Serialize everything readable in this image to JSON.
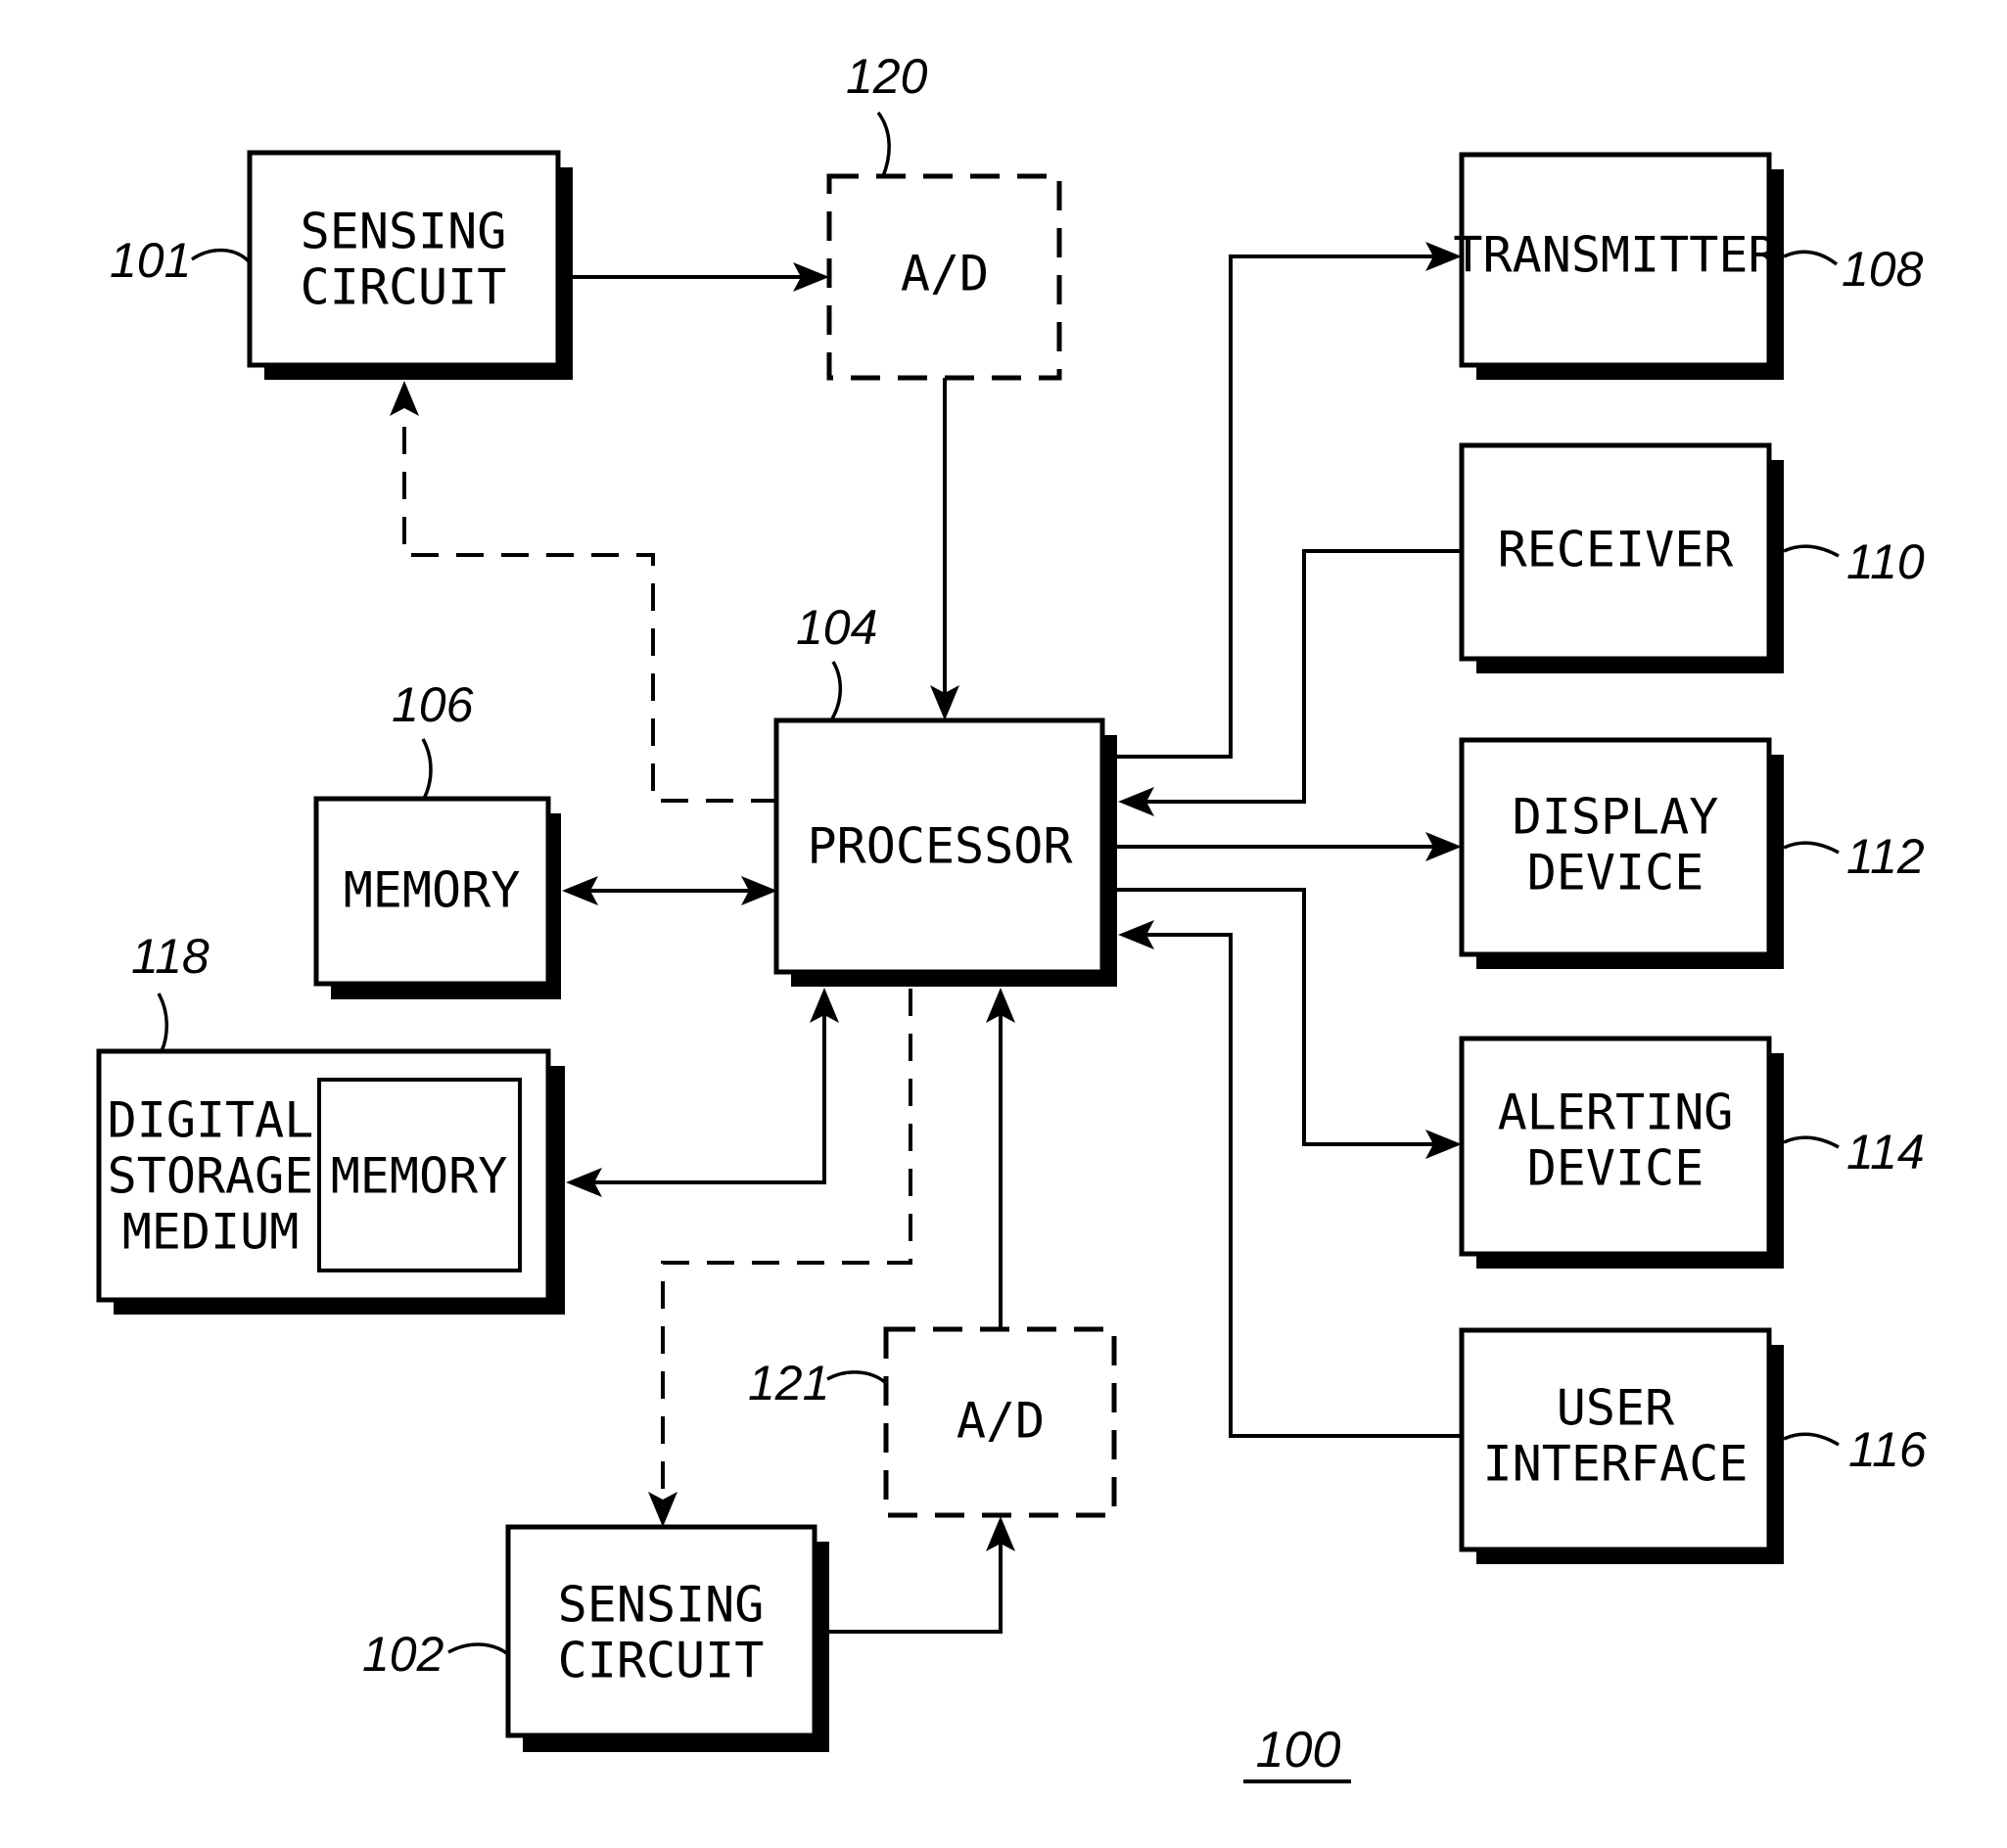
{
  "figure": {
    "reference": "100",
    "blocks": {
      "sensing_circuit_1": {
        "ref": "101",
        "lines": [
          "SENSING",
          "CIRCUIT"
        ]
      },
      "sensing_circuit_2": {
        "ref": "102",
        "lines": [
          "SENSING",
          "CIRCUIT"
        ]
      },
      "processor": {
        "ref": "104",
        "lines": [
          "PROCESSOR"
        ]
      },
      "memory": {
        "ref": "106",
        "lines": [
          "MEMORY"
        ]
      },
      "transmitter": {
        "ref": "108",
        "lines": [
          "TRANSMITTER"
        ]
      },
      "receiver": {
        "ref": "110",
        "lines": [
          "RECEIVER"
        ]
      },
      "display_device": {
        "ref": "112",
        "lines": [
          "DISPLAY",
          "DEVICE"
        ]
      },
      "alerting_device": {
        "ref": "114",
        "lines": [
          "ALERTING",
          "DEVICE"
        ]
      },
      "user_interface": {
        "ref": "116",
        "lines": [
          "USER",
          "INTERFACE"
        ]
      },
      "digital_storage_medium": {
        "ref": "118",
        "lines": [
          "DIGITAL",
          "STORAGE",
          "MEDIUM"
        ],
        "inner_lines": [
          "MEMORY"
        ]
      },
      "ad_converter_1": {
        "ref": "120",
        "lines": [
          "A/D"
        ],
        "optional": true
      },
      "ad_converter_2": {
        "ref": "121",
        "lines": [
          "A/D"
        ],
        "optional": true
      }
    },
    "connections": [
      {
        "from": "sensing_circuit_1",
        "to": "ad_converter_1",
        "style": "solid"
      },
      {
        "from": "ad_converter_1",
        "to": "processor",
        "style": "solid"
      },
      {
        "from": "processor",
        "to": "sensing_circuit_1",
        "style": "dashed"
      },
      {
        "from": "processor",
        "to": "memory",
        "style": "solid",
        "bidirectional": true
      },
      {
        "from": "processor",
        "to": "digital_storage_medium",
        "style": "solid",
        "bidirectional": true
      },
      {
        "from": "processor",
        "to": "sensing_circuit_2",
        "style": "dashed"
      },
      {
        "from": "sensing_circuit_2",
        "to": "ad_converter_2",
        "style": "solid"
      },
      {
        "from": "ad_converter_2",
        "to": "processor",
        "style": "solid"
      },
      {
        "from": "processor",
        "to": "transmitter",
        "style": "solid"
      },
      {
        "from": "receiver",
        "to": "processor",
        "style": "solid"
      },
      {
        "from": "processor",
        "to": "display_device",
        "style": "solid"
      },
      {
        "from": "processor",
        "to": "alerting_device",
        "style": "solid"
      },
      {
        "from": "user_interface",
        "to": "processor",
        "style": "solid"
      }
    ]
  }
}
